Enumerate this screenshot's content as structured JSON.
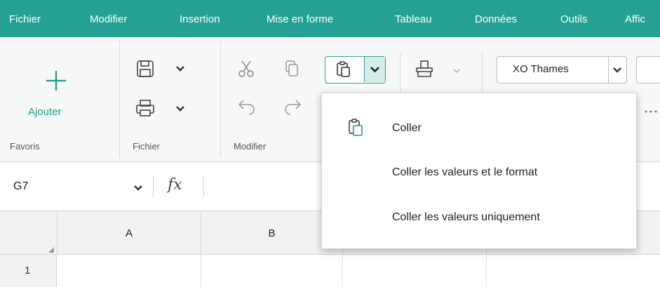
{
  "menubar": {
    "items": [
      "Fichier",
      "Modifier",
      "Insertion",
      "Mise en forme",
      "Tableau",
      "Données",
      "Outils",
      "Affic"
    ],
    "color": "#25a193"
  },
  "ribbon": {
    "favoris": {
      "add_label": "Ajouter",
      "group_label": "Favoris"
    },
    "fichier": {
      "group_label": "Fichier"
    },
    "modifier": {
      "group_label": "Modifier"
    },
    "font": {
      "name": "XO Thames"
    }
  },
  "formula_bar": {
    "cell_ref": "G7",
    "fx_label": "fx"
  },
  "grid": {
    "columns": [
      "A",
      "B"
    ],
    "rows": [
      "1"
    ]
  },
  "paste_menu": {
    "items": [
      {
        "label": "Coller",
        "icon": "paste-icon"
      },
      {
        "label": "Coller les valeurs et le format",
        "icon": ""
      },
      {
        "label": "Coller les valeurs uniquement",
        "icon": ""
      }
    ]
  },
  "colors": {
    "accent": "#1b9a8c",
    "highlight": "#d5ede9"
  }
}
